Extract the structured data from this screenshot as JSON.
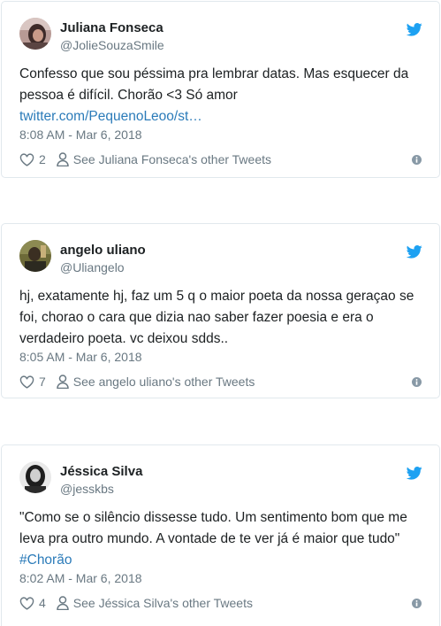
{
  "colors": {
    "text": "#1c2022",
    "muted": "#697882",
    "link": "#2b7bb9",
    "twitter_blue": "#1da1f2",
    "border": "#e1e8ed"
  },
  "tweets": [
    {
      "author": {
        "name": "Juliana Fonseca",
        "handle": "@JolieSouzaSmile"
      },
      "text": "Confesso que sou péssima pra lembrar datas. Mas esquecer da pessoa é difícil. Chorão <3  Só amor",
      "link": "twitter.com/PequenoLeoo/st…",
      "timestamp": "8:08 AM - Mar 6, 2018",
      "likes": "2",
      "see_other": "See Juliana Fonseca's other Tweets"
    },
    {
      "author": {
        "name": "angelo uliano",
        "handle": "@Uliangelo"
      },
      "text": "hj, exatamente hj, faz um 5 q o maior poeta da nossa geraçao se foi, chorao o cara que dizia nao saber fazer poesia e era o verdadeiro poeta. vc deixou sdds..",
      "timestamp": "8:05 AM - Mar 6, 2018",
      "likes": "7",
      "see_other": "See angelo uliano's other Tweets"
    },
    {
      "author": {
        "name": "Jéssica Silva",
        "handle": "@jesskbs"
      },
      "text": "\"Como se o silêncio dissesse tudo. Um sentimento bom que me leva pra outro mundo. A vontade de te ver já é maior que tudo\"",
      "hashtag": "#Chorão",
      "timestamp": "8:02 AM - Mar 6, 2018",
      "likes": "4",
      "see_other": "See Jéssica Silva's other Tweets"
    }
  ],
  "icons": {
    "brand": "twitter-bird-icon",
    "like": "heart-icon",
    "profile": "person-icon",
    "info": "info-icon"
  }
}
